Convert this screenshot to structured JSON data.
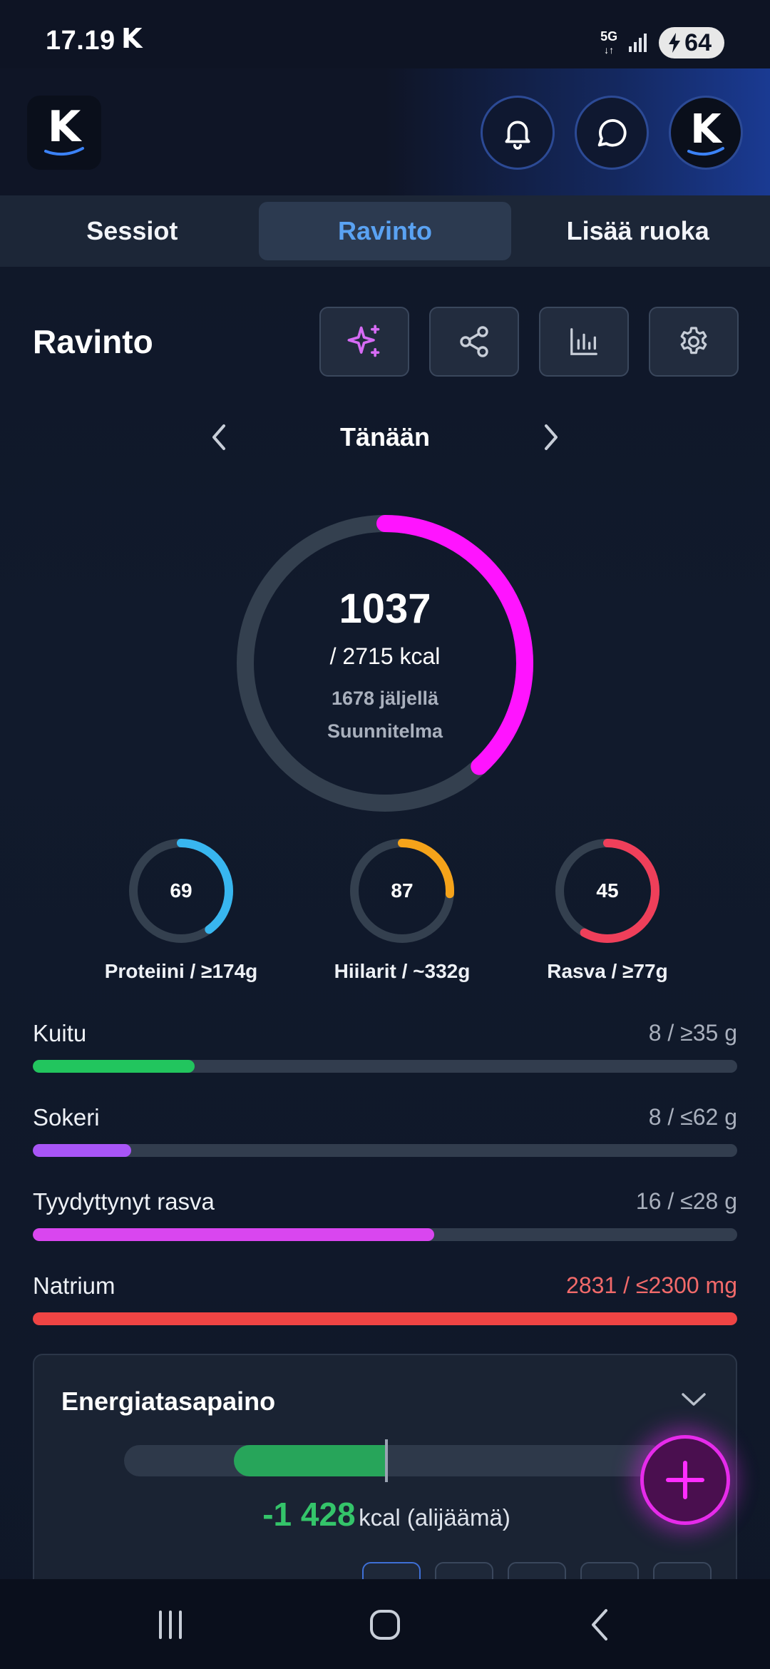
{
  "status_bar": {
    "time": "17.19",
    "app_indicator": "K",
    "network": "5G",
    "battery": "64"
  },
  "header": {
    "logo_letter": "K",
    "avatar_letter": "K",
    "icons": [
      "bell-icon",
      "chat-icon",
      "avatar"
    ]
  },
  "tabs": [
    {
      "label": "Sessiot",
      "active": false
    },
    {
      "label": "Ravinto",
      "active": true
    },
    {
      "label": "Lisää ruoka",
      "active": false
    }
  ],
  "title": "Ravinto",
  "toolbar_icons": [
    "sparkle-icon",
    "share-icon",
    "bar-chart-icon",
    "settings-icon"
  ],
  "date_nav": {
    "label": "Tänään"
  },
  "calories": {
    "consumed": "1037",
    "goal_text": "/ 2715 kcal",
    "remaining_text": "1678 jäljellä",
    "plan_text": "Suunnitelma",
    "consumed_value": 1037,
    "goal_value": 2715,
    "ring_color": "#ff14ff"
  },
  "macros": [
    {
      "value": "69",
      "label": "Proteiini / ≥174g",
      "fraction": 0.4,
      "color": "#38b6ef"
    },
    {
      "value": "87",
      "label": "Hiilarit / ~332g",
      "fraction": 0.26,
      "color": "#f5a31a"
    },
    {
      "value": "45",
      "label": "Rasva / ≥77g",
      "fraction": 0.58,
      "color": "#ef3f5a"
    }
  ],
  "nutrients": [
    {
      "name": "Kuitu",
      "value": "8 / ≥35 g",
      "fraction": 0.23,
      "color": "#22c55e",
      "value_color": "#a9b0bd"
    },
    {
      "name": "Sokeri",
      "value": "8 / ≤62 g",
      "fraction": 0.14,
      "color": "#a855f7",
      "value_color": "#a9b0bd"
    },
    {
      "name": "Tyydyttynyt rasva",
      "value": "16 / ≤28 g",
      "fraction": 0.57,
      "color": "#d946ef",
      "value_color": "#a9b0bd"
    },
    {
      "name": "Natrium",
      "value": "2831 / ≤2300 mg",
      "fraction": 1.0,
      "color": "#ef4444",
      "value_color": "#f26a6a"
    }
  ],
  "energy": {
    "title": "Energiatasapaino",
    "value": "-1 428",
    "unit": "kcal (alijäämä)"
  },
  "fab": {
    "icon": "plus-icon"
  },
  "nav": {
    "icons": [
      "recent-apps-icon",
      "home-icon",
      "back-icon"
    ]
  }
}
